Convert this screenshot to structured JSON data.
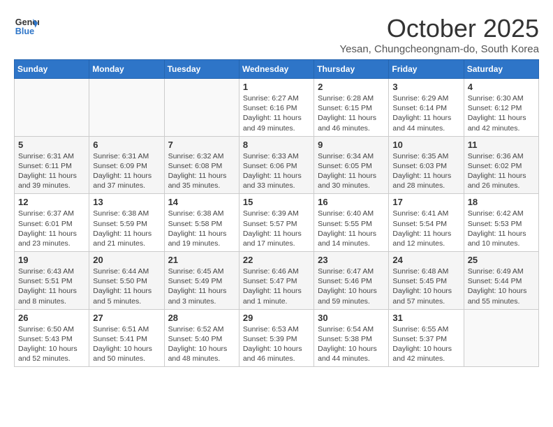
{
  "header": {
    "logo_line1": "General",
    "logo_line2": "Blue",
    "month": "October 2025",
    "location": "Yesan, Chungcheongnam-do, South Korea"
  },
  "weekdays": [
    "Sunday",
    "Monday",
    "Tuesday",
    "Wednesday",
    "Thursday",
    "Friday",
    "Saturday"
  ],
  "weeks": [
    [
      {
        "day": "",
        "info": ""
      },
      {
        "day": "",
        "info": ""
      },
      {
        "day": "",
        "info": ""
      },
      {
        "day": "1",
        "info": "Sunrise: 6:27 AM\nSunset: 6:16 PM\nDaylight: 11 hours and 49 minutes."
      },
      {
        "day": "2",
        "info": "Sunrise: 6:28 AM\nSunset: 6:15 PM\nDaylight: 11 hours and 46 minutes."
      },
      {
        "day": "3",
        "info": "Sunrise: 6:29 AM\nSunset: 6:14 PM\nDaylight: 11 hours and 44 minutes."
      },
      {
        "day": "4",
        "info": "Sunrise: 6:30 AM\nSunset: 6:12 PM\nDaylight: 11 hours and 42 minutes."
      }
    ],
    [
      {
        "day": "5",
        "info": "Sunrise: 6:31 AM\nSunset: 6:11 PM\nDaylight: 11 hours and 39 minutes."
      },
      {
        "day": "6",
        "info": "Sunrise: 6:31 AM\nSunset: 6:09 PM\nDaylight: 11 hours and 37 minutes."
      },
      {
        "day": "7",
        "info": "Sunrise: 6:32 AM\nSunset: 6:08 PM\nDaylight: 11 hours and 35 minutes."
      },
      {
        "day": "8",
        "info": "Sunrise: 6:33 AM\nSunset: 6:06 PM\nDaylight: 11 hours and 33 minutes."
      },
      {
        "day": "9",
        "info": "Sunrise: 6:34 AM\nSunset: 6:05 PM\nDaylight: 11 hours and 30 minutes."
      },
      {
        "day": "10",
        "info": "Sunrise: 6:35 AM\nSunset: 6:03 PM\nDaylight: 11 hours and 28 minutes."
      },
      {
        "day": "11",
        "info": "Sunrise: 6:36 AM\nSunset: 6:02 PM\nDaylight: 11 hours and 26 minutes."
      }
    ],
    [
      {
        "day": "12",
        "info": "Sunrise: 6:37 AM\nSunset: 6:01 PM\nDaylight: 11 hours and 23 minutes."
      },
      {
        "day": "13",
        "info": "Sunrise: 6:38 AM\nSunset: 5:59 PM\nDaylight: 11 hours and 21 minutes."
      },
      {
        "day": "14",
        "info": "Sunrise: 6:38 AM\nSunset: 5:58 PM\nDaylight: 11 hours and 19 minutes."
      },
      {
        "day": "15",
        "info": "Sunrise: 6:39 AM\nSunset: 5:57 PM\nDaylight: 11 hours and 17 minutes."
      },
      {
        "day": "16",
        "info": "Sunrise: 6:40 AM\nSunset: 5:55 PM\nDaylight: 11 hours and 14 minutes."
      },
      {
        "day": "17",
        "info": "Sunrise: 6:41 AM\nSunset: 5:54 PM\nDaylight: 11 hours and 12 minutes."
      },
      {
        "day": "18",
        "info": "Sunrise: 6:42 AM\nSunset: 5:53 PM\nDaylight: 11 hours and 10 minutes."
      }
    ],
    [
      {
        "day": "19",
        "info": "Sunrise: 6:43 AM\nSunset: 5:51 PM\nDaylight: 11 hours and 8 minutes."
      },
      {
        "day": "20",
        "info": "Sunrise: 6:44 AM\nSunset: 5:50 PM\nDaylight: 11 hours and 5 minutes."
      },
      {
        "day": "21",
        "info": "Sunrise: 6:45 AM\nSunset: 5:49 PM\nDaylight: 11 hours and 3 minutes."
      },
      {
        "day": "22",
        "info": "Sunrise: 6:46 AM\nSunset: 5:47 PM\nDaylight: 11 hours and 1 minute."
      },
      {
        "day": "23",
        "info": "Sunrise: 6:47 AM\nSunset: 5:46 PM\nDaylight: 10 hours and 59 minutes."
      },
      {
        "day": "24",
        "info": "Sunrise: 6:48 AM\nSunset: 5:45 PM\nDaylight: 10 hours and 57 minutes."
      },
      {
        "day": "25",
        "info": "Sunrise: 6:49 AM\nSunset: 5:44 PM\nDaylight: 10 hours and 55 minutes."
      }
    ],
    [
      {
        "day": "26",
        "info": "Sunrise: 6:50 AM\nSunset: 5:43 PM\nDaylight: 10 hours and 52 minutes."
      },
      {
        "day": "27",
        "info": "Sunrise: 6:51 AM\nSunset: 5:41 PM\nDaylight: 10 hours and 50 minutes."
      },
      {
        "day": "28",
        "info": "Sunrise: 6:52 AM\nSunset: 5:40 PM\nDaylight: 10 hours and 48 minutes."
      },
      {
        "day": "29",
        "info": "Sunrise: 6:53 AM\nSunset: 5:39 PM\nDaylight: 10 hours and 46 minutes."
      },
      {
        "day": "30",
        "info": "Sunrise: 6:54 AM\nSunset: 5:38 PM\nDaylight: 10 hours and 44 minutes."
      },
      {
        "day": "31",
        "info": "Sunrise: 6:55 AM\nSunset: 5:37 PM\nDaylight: 10 hours and 42 minutes."
      },
      {
        "day": "",
        "info": ""
      }
    ]
  ]
}
